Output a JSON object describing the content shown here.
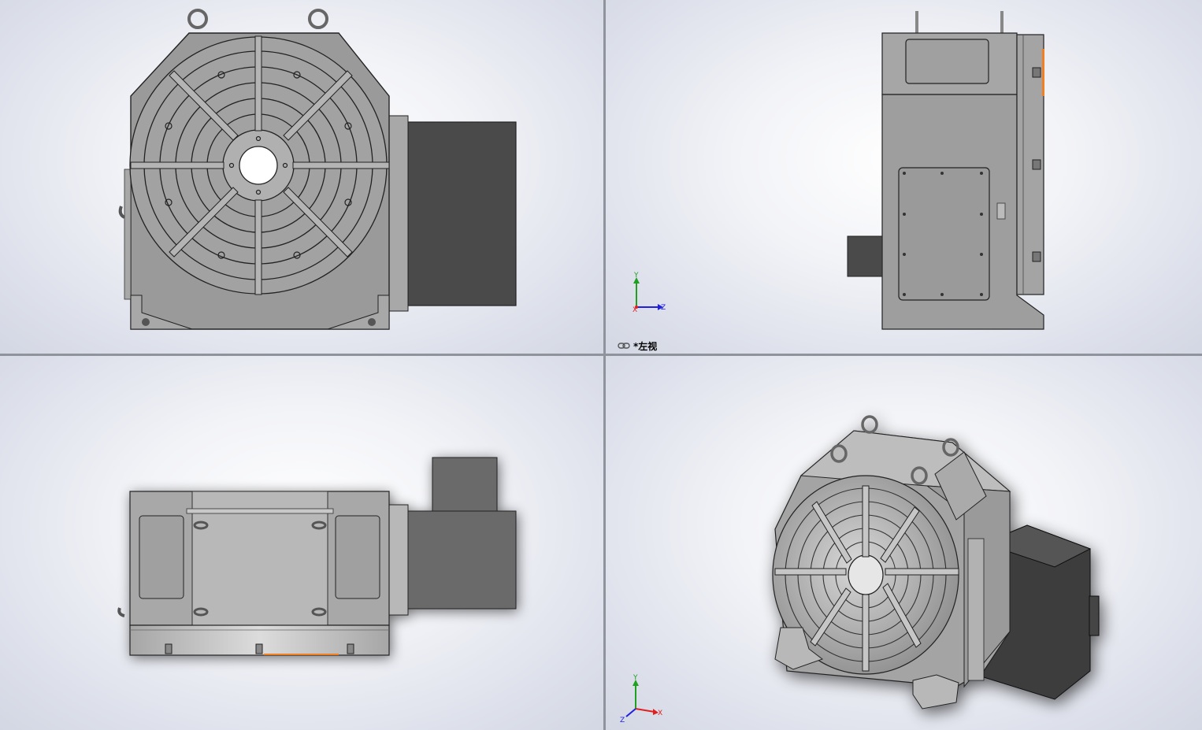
{
  "viewports": {
    "top_left": {
      "name": "front-view"
    },
    "top_right": {
      "name": "left-view",
      "label": "*左视"
    },
    "bottom_left": {
      "name": "top-view"
    },
    "bottom_right": {
      "name": "isometric-view"
    }
  },
  "triad": {
    "x": "X",
    "y": "Y",
    "z": "Z"
  },
  "colors": {
    "body": "#9a9a9a",
    "body_light": "#b4b4b4",
    "motor": "#4a4a4a",
    "edge": "#222222",
    "accent_orange": "#f08020",
    "axis_x": "#e02020",
    "axis_y": "#20a020",
    "axis_z": "#2020e0"
  }
}
